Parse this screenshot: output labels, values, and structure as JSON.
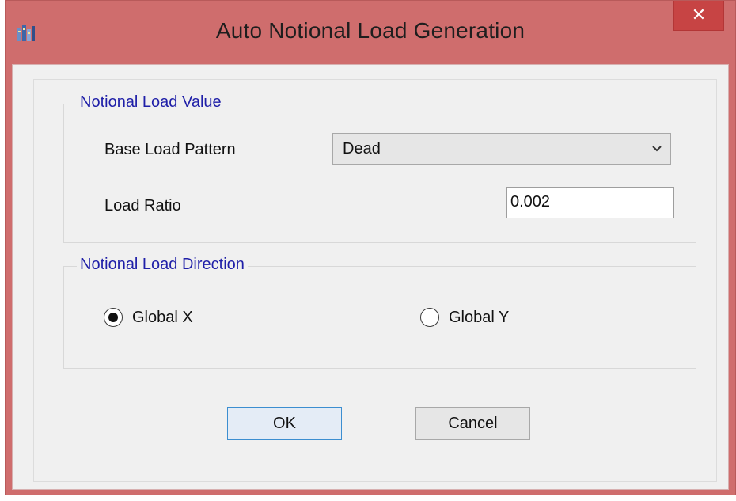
{
  "window": {
    "title": "Auto Notional Load Generation",
    "close_glyph": "✕",
    "app_icon": "etabs-app-icon"
  },
  "value_group": {
    "legend": "Notional Load Value",
    "base_load_pattern_label": "Base Load Pattern",
    "base_load_pattern_value": "Dead",
    "load_ratio_label": "Load Ratio",
    "load_ratio_value": "0.002"
  },
  "direction_group": {
    "legend": "Notional Load Direction",
    "options": [
      {
        "label": "Global X",
        "checked": true
      },
      {
        "label": "Global Y",
        "checked": false
      }
    ]
  },
  "buttons": {
    "ok_label": "OK",
    "cancel_label": "Cancel"
  },
  "colors": {
    "frame": "#cf6d6d",
    "close_button": "#c74444",
    "legend_text": "#1f1fa8",
    "client_bg": "#f0f0f0"
  }
}
